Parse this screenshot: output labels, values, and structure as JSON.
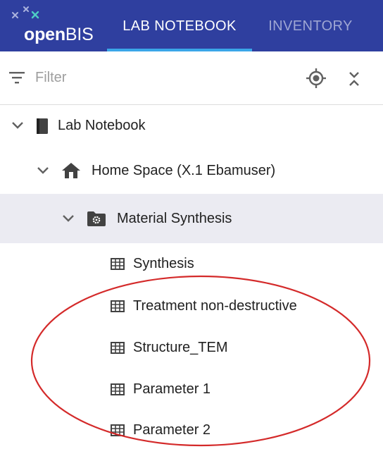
{
  "header": {
    "logo": {
      "part1": "open",
      "part2": "BIS"
    },
    "tabs": [
      {
        "label": "LAB NOTEBOOK",
        "active": true
      },
      {
        "label": "INVENTORY",
        "active": false
      }
    ],
    "colors": {
      "background": "#2f3f9f",
      "active_indicator": "#3aa6e8",
      "inactive_tab": "#9ea6d3"
    }
  },
  "filter": {
    "placeholder": "Filter",
    "value": "",
    "icons": [
      "filter-list-icon",
      "locate-icon",
      "collapse-all-icon"
    ]
  },
  "tree": {
    "root": {
      "label": "Lab Notebook",
      "icon": "book-icon",
      "expanded": true
    },
    "space": {
      "label": "Home Space (X.1 Ebamuser)",
      "icon": "home-icon",
      "expanded": true
    },
    "project": {
      "label": "Material Synthesis",
      "icon": "folder-settings-icon",
      "expanded": true,
      "selected": true
    },
    "collections": [
      {
        "label": "Synthesis",
        "icon": "table-icon"
      },
      {
        "label": "Treatment non-destructive",
        "icon": "table-icon"
      },
      {
        "label": "Structure_TEM",
        "icon": "table-icon"
      },
      {
        "label": "Parameter 1",
        "icon": "table-icon"
      },
      {
        "label": "Parameter 2",
        "icon": "table-icon"
      }
    ]
  },
  "annotation": {
    "shape": "ellipse",
    "color": "#d42a2a"
  }
}
